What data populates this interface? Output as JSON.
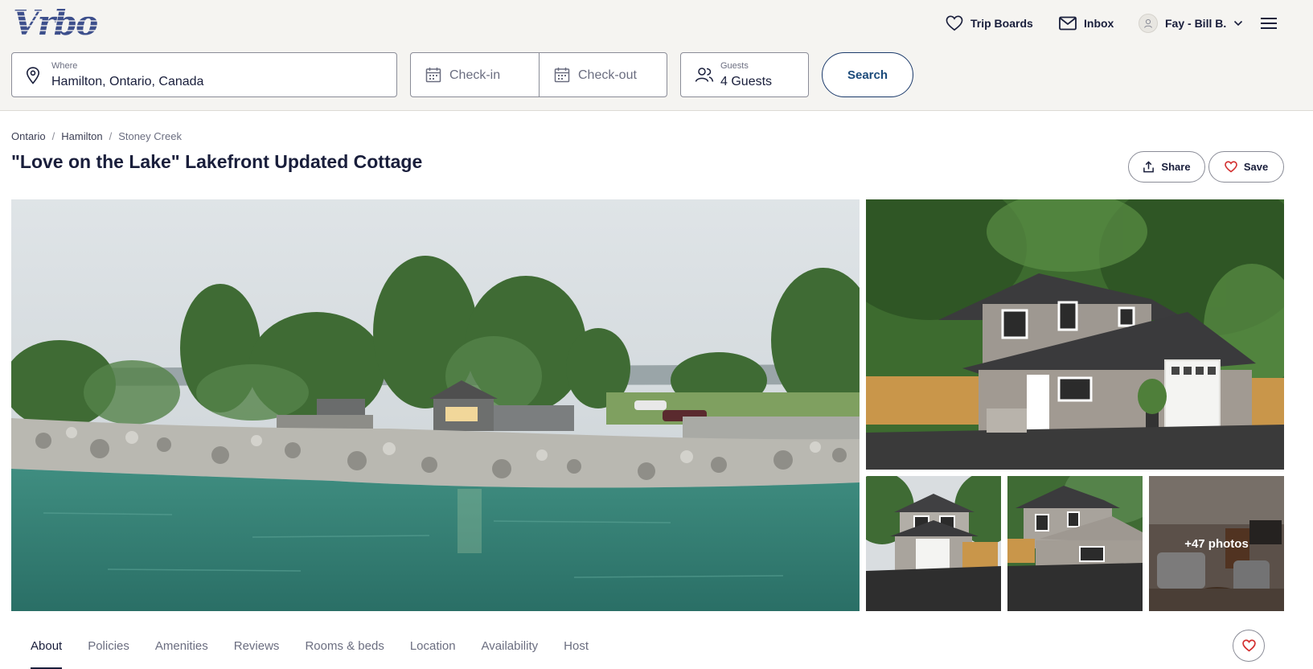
{
  "brand": {
    "logo_text": "Vrbo"
  },
  "nav": {
    "trip_boards": "Trip Boards",
    "inbox": "Inbox",
    "user": "Fay - Bill B."
  },
  "search": {
    "where_label": "Where",
    "where_value": "Hamilton, Ontario, Canada",
    "checkin_placeholder": "Check-in",
    "checkout_placeholder": "Check-out",
    "guests_label": "Guests",
    "guests_value": "4 Guests",
    "search_label": "Search"
  },
  "breadcrumb": [
    "Ontario",
    "Hamilton",
    "Stoney Creek"
  ],
  "listing": {
    "title": "\"Love on the Lake\" Lakefront Updated Cottage",
    "share_label": "Share",
    "save_label": "Save"
  },
  "gallery": {
    "more_photos_label": "+47 photos"
  },
  "tabs": [
    "About",
    "Policies",
    "Amenities",
    "Reviews",
    "Rooms & beds",
    "Location",
    "Availability",
    "Host"
  ],
  "active_tab": "About",
  "colors": {
    "header_bg": "#f5f4f1",
    "text_primary": "#191e3b",
    "accent_blue": "#1b4a7a",
    "heart_red": "#d32f2f"
  }
}
